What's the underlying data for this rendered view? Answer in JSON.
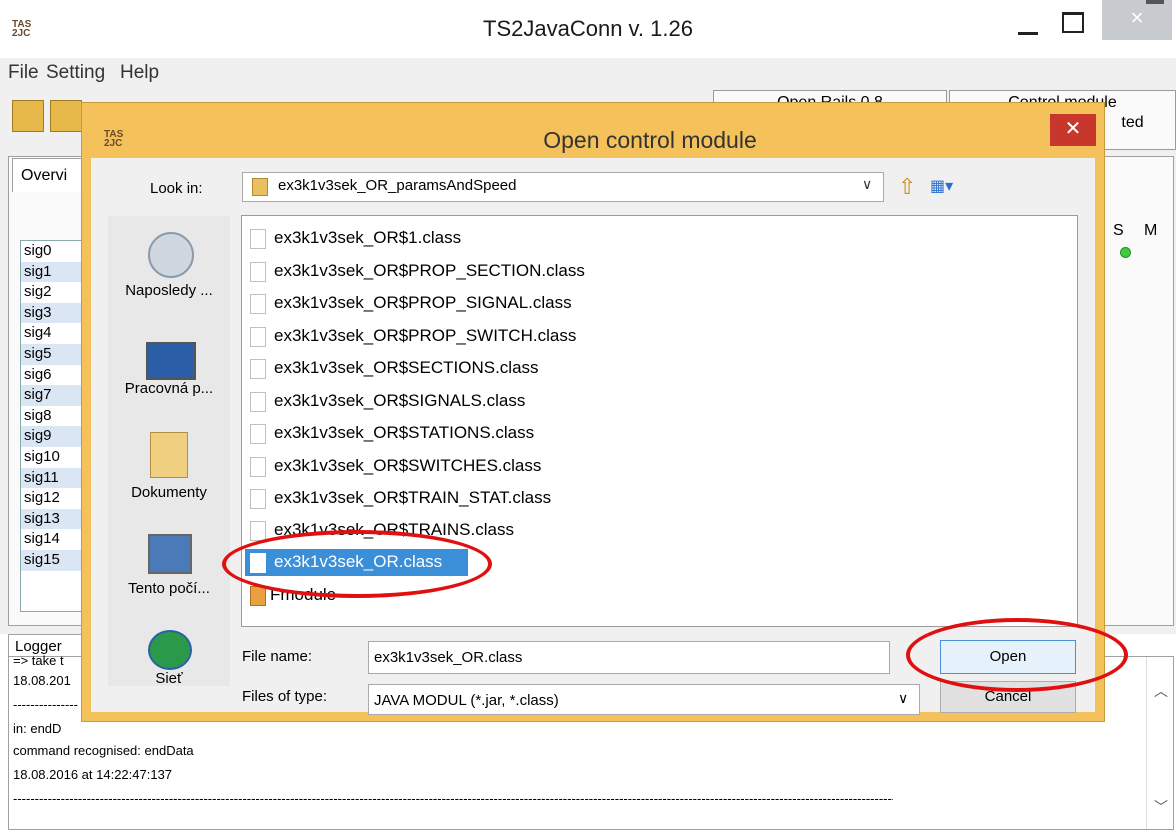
{
  "window": {
    "title": "TS2JavaConn v. 1.26",
    "app_icon": "TAS\n2JC",
    "close_glyph": "×"
  },
  "menu": [
    "File",
    "Setting",
    "Help"
  ],
  "toolbar": {
    "status_boxes": [
      {
        "line1": "Open Rails 0.8",
        "line2": ""
      },
      {
        "line1": "Control module",
        "line2": "ted"
      }
    ]
  },
  "tabs": {
    "overview": "Overvi",
    "logger": "Logger"
  },
  "signals": [
    "sig0",
    "sig1",
    "sig2",
    "sig3",
    "sig4",
    "sig5",
    "sig6",
    "sig7",
    "sig8",
    "sig9",
    "sig10",
    "sig11",
    "sig12",
    "sig13",
    "sig14",
    "sig15"
  ],
  "columns": {
    "s": "S",
    "m": "M"
  },
  "log_lines": [
    "=> take t",
    "18.08.201",
    "---------------",
    "in: endD",
    "   command recognised: endData",
    "18.08.2016 at 14:22:47:137",
    "----------------------------------------------------------------------------------------------------------------------------------------------------------------------------------------------------------------------------"
  ],
  "dialog": {
    "title": "Open control module",
    "icon": "TAS\n2JC",
    "close_glyph": "✕",
    "look_in_label": "Look in:",
    "look_in_value": "ex3k1v3sek_OR_paramsAndSpeed",
    "places": [
      "Naposledy ...",
      "Pracovná p...",
      "Dokumenty",
      "Tento počí...",
      "Sieť"
    ],
    "files": [
      "ex3k1v3sek_OR$1.class",
      "ex3k1v3sek_OR$PROP_SECTION.class",
      "ex3k1v3sek_OR$PROP_SIGNAL.class",
      "ex3k1v3sek_OR$PROP_SWITCH.class",
      "ex3k1v3sek_OR$SECTIONS.class",
      "ex3k1v3sek_OR$SIGNALS.class",
      "ex3k1v3sek_OR$STATIONS.class",
      "ex3k1v3sek_OR$SWITCHES.class",
      "ex3k1v3sek_OR$TRAIN_STAT.class",
      "ex3k1v3sek_OR$TRAINS.class",
      "ex3k1v3sek_OR.class",
      "Fmodule"
    ],
    "selected_index": 10,
    "file_name_label": "File name:",
    "file_name_value": "ex3k1v3sek_OR.class",
    "file_type_label": "Files of type:",
    "file_type_value": "JAVA MODUL (*.jar, *.class)",
    "open_label": "Open",
    "cancel_label": "Cancel"
  },
  "colors": {
    "dialog_frame": "#f5c15a",
    "selection": "#3a8fd8",
    "annotation": "#e01010"
  }
}
